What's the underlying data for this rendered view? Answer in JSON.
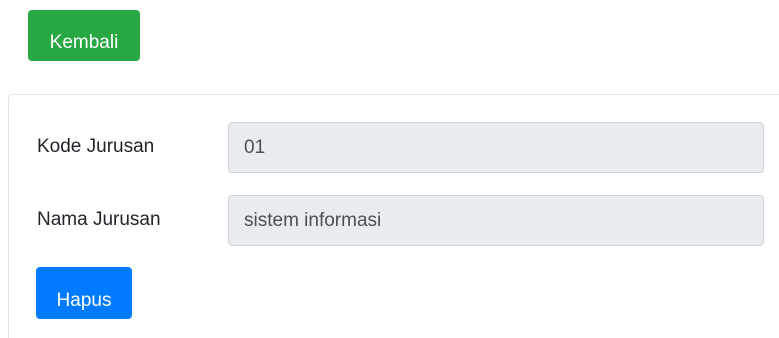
{
  "toolbar": {
    "back_label": "Kembali"
  },
  "form": {
    "kode_jurusan": {
      "label": "Kode Jurusan",
      "value": "01"
    },
    "nama_jurusan": {
      "label": "Nama Jurusan",
      "value": "sistem informasi"
    },
    "delete_label": "Hapus"
  },
  "colors": {
    "back_button": "#28a745",
    "delete_button": "#007bff",
    "readonly_field": "#e9ecef"
  }
}
